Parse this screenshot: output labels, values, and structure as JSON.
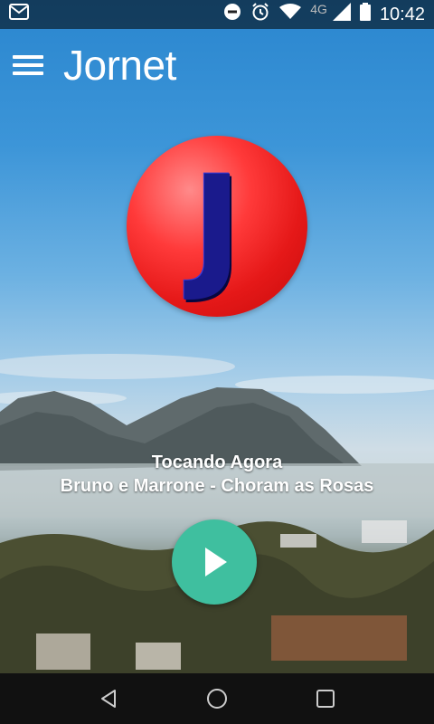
{
  "status_bar": {
    "network": "4G",
    "time": "10:42",
    "icons": [
      "mail-icon",
      "do-not-disturb-icon",
      "alarm-icon",
      "wifi-icon",
      "signal-icon",
      "battery-icon"
    ]
  },
  "app_bar": {
    "title": "Jornet",
    "menu_icon": "hamburger-menu-icon"
  },
  "logo": {
    "letter": "J",
    "circle_color": "#e51818",
    "letter_color": "#1a1a8c"
  },
  "player": {
    "now_playing_label": "Tocando Agora",
    "track": "Bruno e Marrone - Choram as Rosas",
    "play_icon": "play-icon",
    "button_color": "#3fbf9f"
  },
  "nav_bar": {
    "icons": [
      "back-icon",
      "home-icon",
      "recents-icon"
    ]
  }
}
